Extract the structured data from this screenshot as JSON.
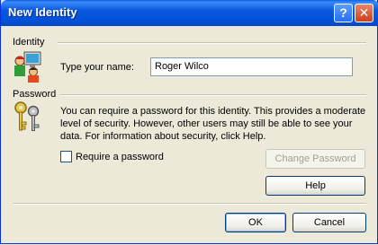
{
  "window": {
    "title": "New Identity"
  },
  "titlebar": {
    "help_glyph": "?",
    "close_glyph": "✕"
  },
  "identity": {
    "section_label": "Identity",
    "name_label": "Type your name:",
    "name_value": "Roger Wilco",
    "icon": "people-computer-icon"
  },
  "password": {
    "section_label": "Password",
    "description": "You can require a password for this identity.  This provides a moderate level of security. However, other users may still be able to see your data. For information about security, click Help.",
    "require_label": "Require a password",
    "require_checked": false,
    "change_button": "Change Password",
    "help_button": "Help",
    "icon": "keys-icon"
  },
  "footer": {
    "ok_button": "OK",
    "cancel_button": "Cancel"
  }
}
